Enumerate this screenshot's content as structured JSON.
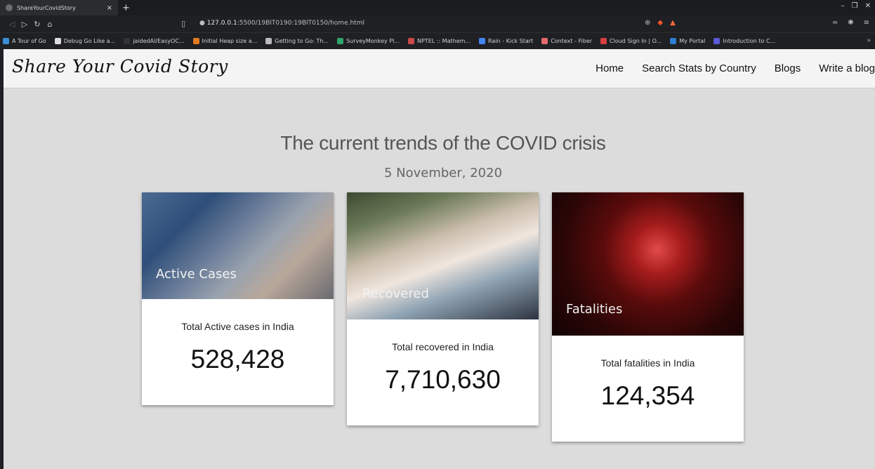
{
  "browser": {
    "tab_title": "ShareYourCovidStory",
    "tab_close": "×",
    "new_tab": "+",
    "url_host": "127.0.0.1",
    "url_path": ":5500/19BIT0190:19BIT0150/home.html",
    "bookmarks": [
      {
        "label": "A Tour of Go",
        "color": "#3b8fd6"
      },
      {
        "label": "Debug Go Like a...",
        "color": "#dddddd"
      },
      {
        "label": "jaidedAI/EasyOC...",
        "color": "#333333"
      },
      {
        "label": "Initial Heap size a...",
        "color": "#e07b1f"
      },
      {
        "label": "Getting to Go: Th...",
        "color": "#bbbbbb"
      },
      {
        "label": "SurveyMonkey Pl...",
        "color": "#2fa36b"
      },
      {
        "label": "NPTEL :: Mathem...",
        "color": "#c94a4a"
      },
      {
        "label": "Rain - Kick Start",
        "color": "#4285f4"
      },
      {
        "label": "Context - Fiber",
        "color": "#e56b6b"
      },
      {
        "label": "Cloud Sign In | O...",
        "color": "#d43f3f"
      },
      {
        "label": "My Portal",
        "color": "#2f7dd1"
      },
      {
        "label": "Introduction to C...",
        "color": "#5a5ad6"
      }
    ]
  },
  "site": {
    "logo": "Share Your Covid Story",
    "nav": [
      "Home",
      "Search Stats by Country",
      "Blogs",
      "Write a blog"
    ]
  },
  "main": {
    "heading": "The current trends of the COVID crisis",
    "date": "5 November, 2020",
    "cards": [
      {
        "image_label": "Active Cases",
        "caption": "Total Active cases in India",
        "count": "528,428"
      },
      {
        "image_label": "Recovered",
        "caption": "Total recovered in India",
        "count": "7,710,630"
      },
      {
        "image_label": "Fatalities",
        "caption": "Total fatalities in India",
        "count": "124,354"
      }
    ]
  }
}
